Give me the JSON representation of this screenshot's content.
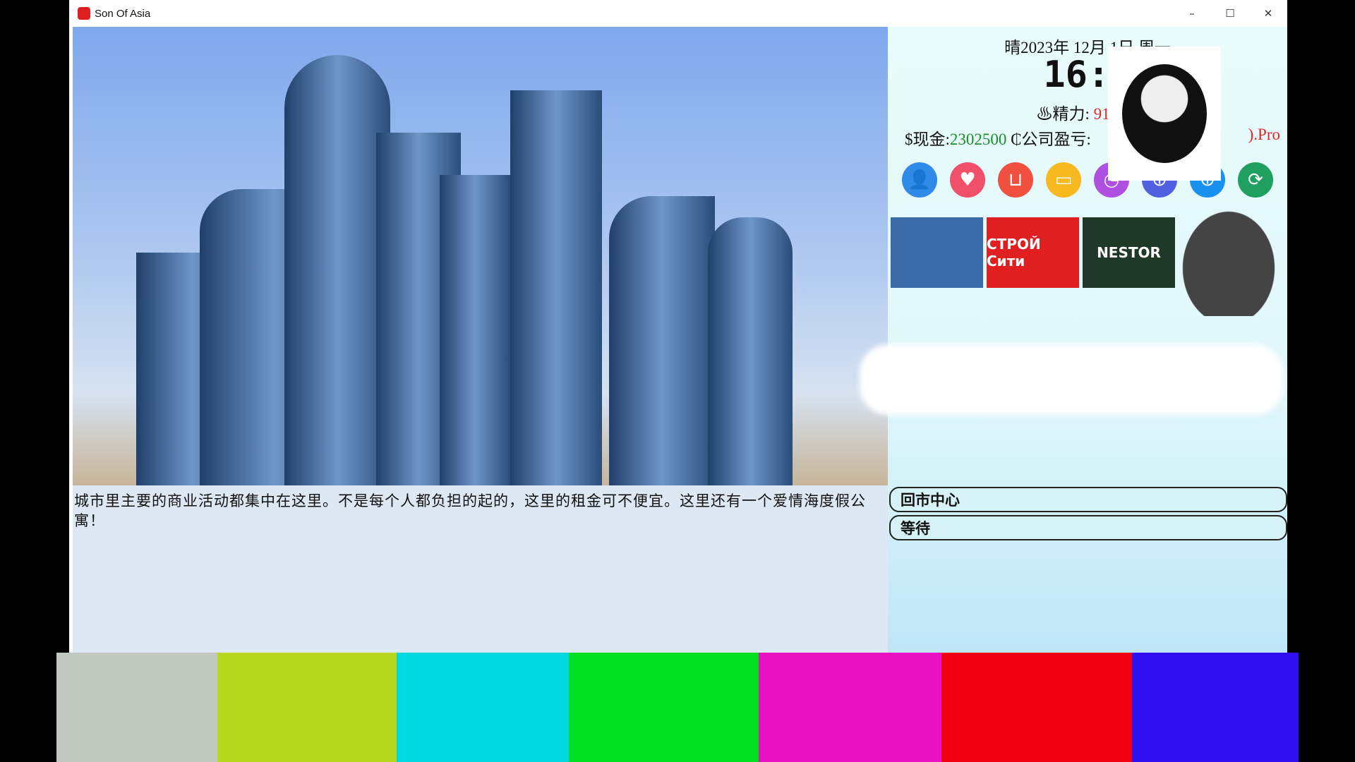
{
  "window": {
    "title": "Son Of Asia",
    "minimize": "–",
    "maximize": "☐",
    "close": "✕"
  },
  "description": "城市里主要的商业活动都集中在这里。不是每个人都负担的起的，这里的租金可不便宜。这里还有一个爱情海度假公寓！",
  "status": {
    "weather_icon": "☀",
    "date": "晴2023年 12月 1日 周一",
    "time": "16:5",
    "energy_label": "♨精力: ",
    "energy_value": "91/401",
    "cash_label": "$现金:",
    "cash_value": "2302500",
    "company_label": " ₵公司盈亏:",
    "company_suffix": ").Pro"
  },
  "icons": [
    {
      "name": "profile-icon",
      "glyph": "👤",
      "color": "#2f8ae8"
    },
    {
      "name": "heart-icon",
      "glyph": "♥",
      "color": "#f0506a"
    },
    {
      "name": "shopping-bag-icon",
      "glyph": "⊔",
      "color": "#f05040"
    },
    {
      "name": "notebook-icon",
      "glyph": "▭",
      "color": "#f8b820"
    },
    {
      "name": "clock-add-icon",
      "glyph": "◷",
      "color": "#b050e0"
    },
    {
      "name": "blue-add-icon",
      "glyph": "⊕",
      "color": "#5060e0"
    },
    {
      "name": "cyan-add-icon",
      "glyph": "⊕",
      "color": "#1890f0"
    },
    {
      "name": "24h-icon",
      "glyph": "⟳",
      "color": "#20a060"
    }
  ],
  "logos": [
    {
      "name": "skyscraper-logo",
      "text": "",
      "bg": "#3a6aa8"
    },
    {
      "name": "stroy-siti-logo",
      "text": "СТРОЙ Сити",
      "bg": "#e02020"
    },
    {
      "name": "nestor-logo",
      "text": "NESTOR",
      "bg": "#203828"
    }
  ],
  "actions": [
    {
      "label": "回市中心"
    },
    {
      "label": "等待"
    }
  ],
  "color_bars": [
    "#c0c8c0",
    "#b8d820",
    "#00d8e0",
    "#00e020",
    "#e810c0",
    "#f00010",
    "#3010f0"
  ]
}
